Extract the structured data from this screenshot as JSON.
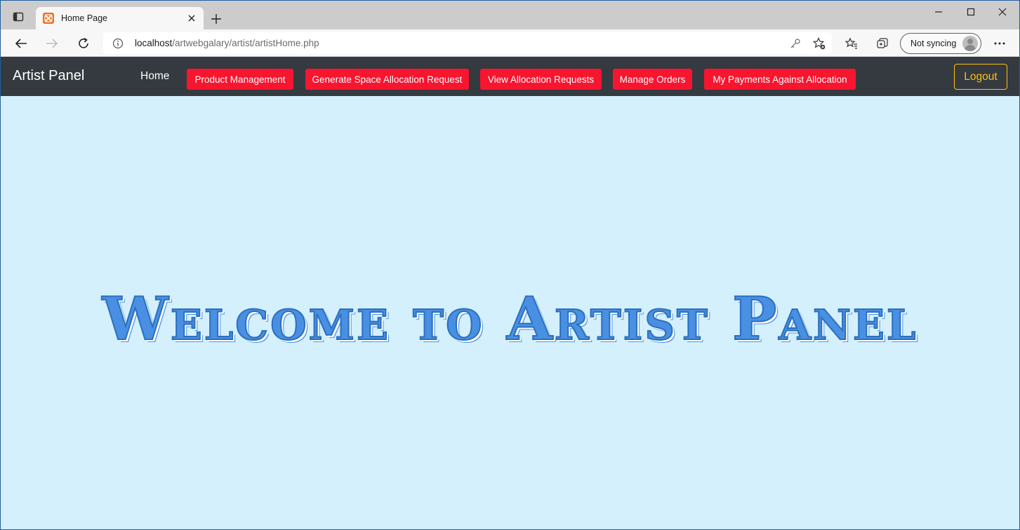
{
  "browser": {
    "tab": {
      "title": "Home Page"
    },
    "address": {
      "host": "localhost",
      "path": "/artwebgalary/artist/artistHome.php"
    },
    "profile": {
      "sync_label": "Not syncing"
    },
    "icons": [
      "tab-actions-icon",
      "xampp-favicon",
      "close-icon",
      "plus-icon",
      "minimize-icon",
      "maximize-icon",
      "close-window-icon",
      "back-icon",
      "forward-icon",
      "refresh-icon",
      "info-icon",
      "key-icon",
      "add-favorite-icon",
      "favorites-icon",
      "collections-icon",
      "avatar",
      "more-icon"
    ]
  },
  "navbar": {
    "brand": "Artist Panel",
    "home": "Home",
    "links": [
      {
        "label": "Product Management"
      },
      {
        "label": "Generate Space Allocation Request"
      },
      {
        "label": "View Allocation Requests"
      },
      {
        "label": "Manage Orders"
      },
      {
        "label": "My Payments Against Allocation"
      }
    ],
    "logout": "Logout"
  },
  "main": {
    "heading": "Welcome to Artist Panel"
  },
  "colors": {
    "navbar_bg": "#343a40",
    "nav_button": "#f7152f",
    "logout": "#ffc107",
    "page_bg": "#d4f0fc",
    "heading": "#4a90e2"
  }
}
